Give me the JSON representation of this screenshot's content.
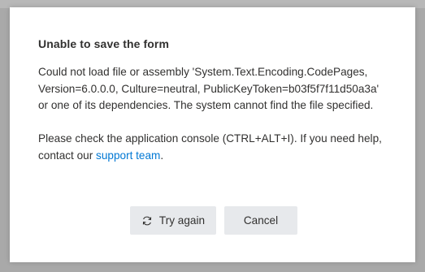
{
  "dialog": {
    "title": "Unable to save the form",
    "message_line1": "Could not load file or assembly 'System.Text.Encoding.CodePages,",
    "message_line2": "Version=6.0.0.0, Culture=neutral, PublicKeyToken=b03f5f7f11d50a3a'",
    "message_line3": "or one of its dependencies. The system cannot find the file specified.",
    "help_line1": "Please check the application console (CTRL+ALT+I). If you need help,",
    "help_line2_prefix": "contact our ",
    "help_link": "support team",
    "help_line2_suffix": "."
  },
  "buttons": {
    "retry_label": "Try again",
    "retry_icon": "refresh-icon",
    "cancel_label": "Cancel"
  },
  "colors": {
    "link": "#0078d4",
    "text": "#323130",
    "button_bg": "#e7e9ec",
    "overlay": "#a9a9a9"
  }
}
